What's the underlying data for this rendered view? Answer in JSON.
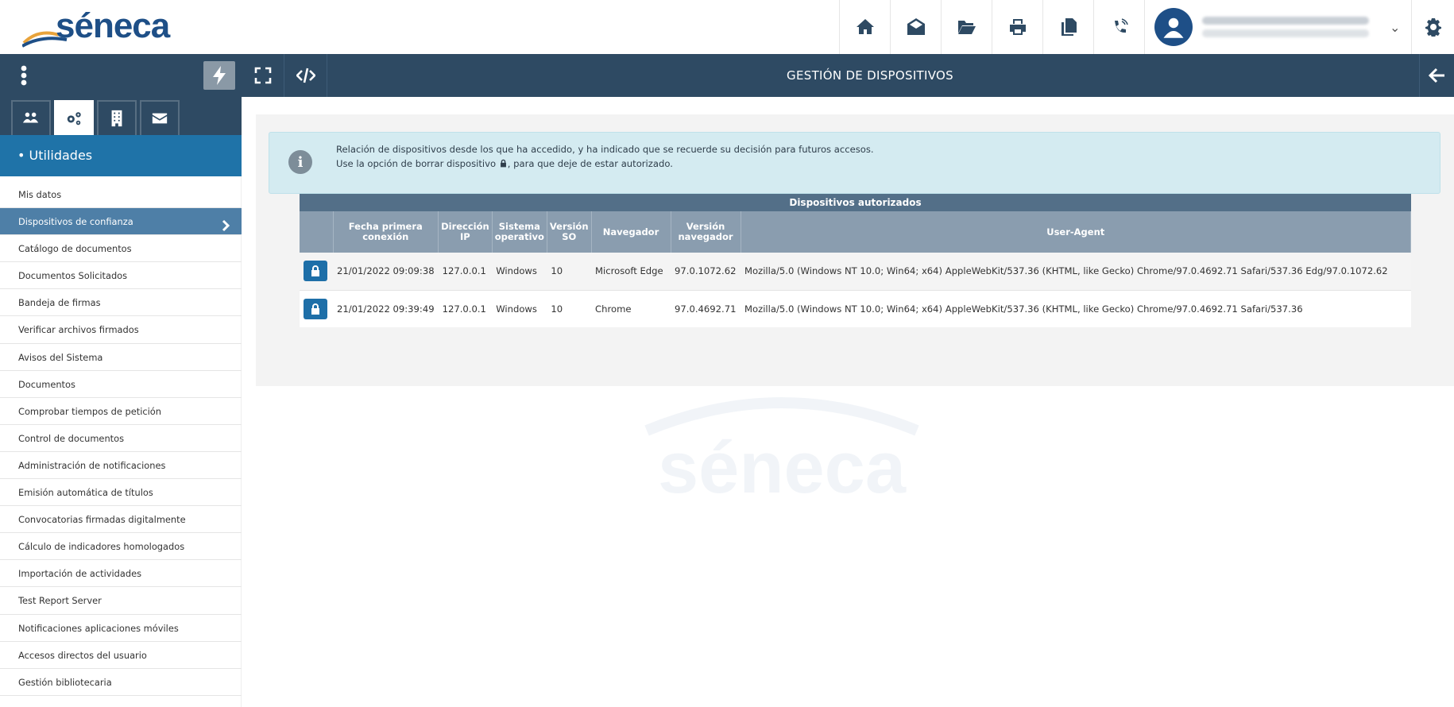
{
  "app": {
    "logo_text": "séneca"
  },
  "header": {
    "icons": [
      "home-icon",
      "mail-open-icon",
      "folder-open-icon",
      "print-icon",
      "copy-icon",
      "phone-icon"
    ],
    "settings_icon": "gear-icon"
  },
  "titlebar": {
    "title": "GESTIÓN DE DISPOSITIVOS"
  },
  "sidebar": {
    "tabs": [
      "users-icon",
      "cogs-icon",
      "building-icon",
      "envelope-icon"
    ],
    "section": "• Utilidades",
    "items": [
      {
        "label": "Mis datos"
      },
      {
        "label": "Dispositivos de confianza",
        "active": true
      },
      {
        "label": "Catálogo de documentos"
      },
      {
        "label": "Documentos Solicitados"
      },
      {
        "label": "Bandeja de firmas"
      },
      {
        "label": "Verificar archivos firmados"
      },
      {
        "label": "Avisos del Sistema"
      },
      {
        "label": "Documentos"
      },
      {
        "label": "Comprobar tiempos de petición"
      },
      {
        "label": "Control de documentos"
      },
      {
        "label": "Administración de notificaciones"
      },
      {
        "label": "Emisión automática de títulos"
      },
      {
        "label": "Convocatorias firmadas digitalmente"
      },
      {
        "label": "Cálculo de indicadores homologados"
      },
      {
        "label": "Importación de actividades"
      },
      {
        "label": "Test Report Server"
      },
      {
        "label": "Notificaciones aplicaciones móviles"
      },
      {
        "label": "Accesos directos del usuario"
      },
      {
        "label": "Gestión bibliotecaria"
      }
    ]
  },
  "alert": {
    "line1": "Relación de dispositivos desde los que ha accedido, y ha indicado que se recuerde su decisión para futuros accesos.",
    "line2_before": "Use la opción de borrar dispositivo ",
    "line2_after": ", para que deje de estar autorizado."
  },
  "table": {
    "caption": "Dispositivos autorizados",
    "columns": [
      "",
      "Fecha primera conexión",
      "Dirección IP",
      "Sistema operativo",
      "Versión SO",
      "Navegador",
      "Versión navegador",
      "User-Agent"
    ],
    "rows": [
      {
        "fecha": "21/01/2022 09:09:38",
        "ip": "127.0.0.1",
        "so": "Windows",
        "version_so": "10",
        "navegador": "Microsoft Edge",
        "version_nav": "97.0.1072.62",
        "user_agent": "Mozilla/5.0 (Windows NT 10.0; Win64; x64) AppleWebKit/537.36 (KHTML, like Gecko) Chrome/97.0.4692.71 Safari/537.36 Edg/97.0.1072.62"
      },
      {
        "fecha": "21/01/2022 09:39:49",
        "ip": "127.0.0.1",
        "so": "Windows",
        "version_so": "10",
        "navegador": "Chrome",
        "version_nav": "97.0.4692.71",
        "user_agent": "Mozilla/5.0 (Windows NT 10.0; Win64; x64) AppleWebKit/537.36 (KHTML, like Gecko) Chrome/97.0.4692.71 Safari/537.36"
      }
    ]
  },
  "colors": {
    "header_bg": "#2e4a63",
    "sidebar_section": "#1f73a8",
    "sidebar_active": "#4e7fa7",
    "alert_bg": "#d4ebf1",
    "table_caption": "#536f88",
    "table_header": "#8a9daf",
    "lock_button": "#1e6fa8"
  }
}
